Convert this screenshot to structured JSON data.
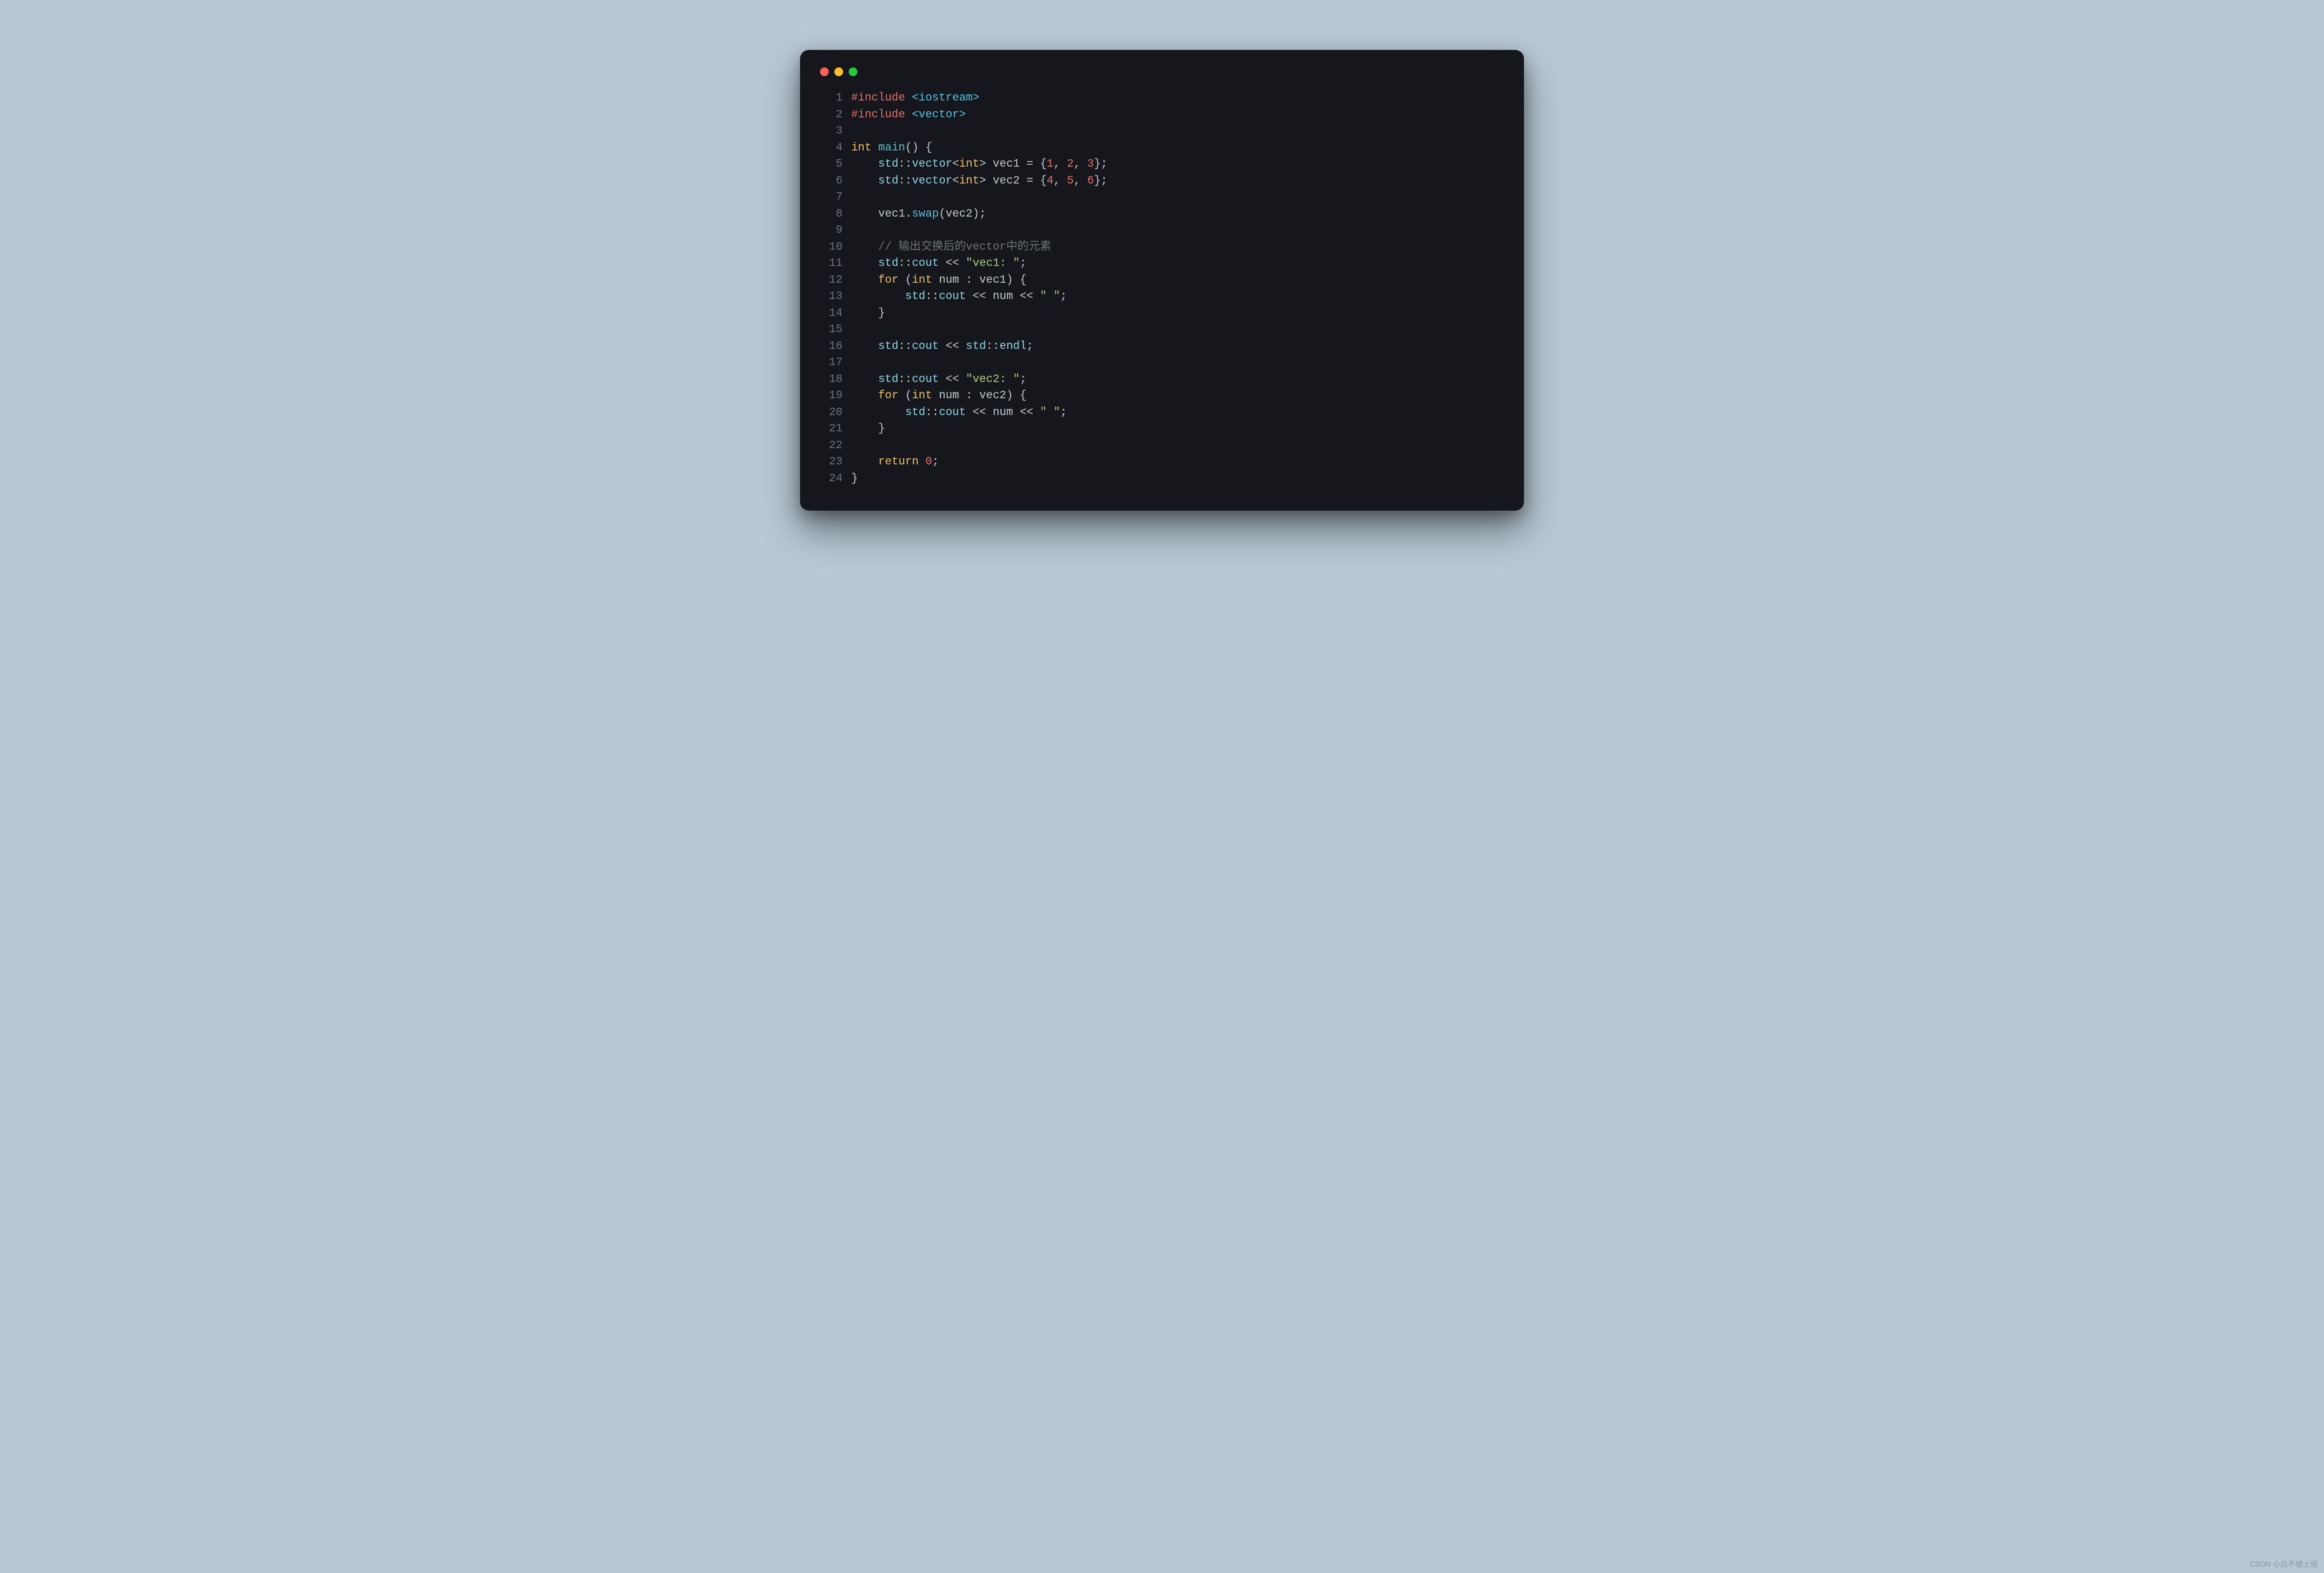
{
  "watermark": "CSDN 小白不想上班",
  "code": {
    "lines": [
      {
        "n": 1,
        "tokens": [
          {
            "t": "#include",
            "c": "pre"
          },
          {
            "t": " "
          },
          {
            "t": "<iostream>",
            "c": "type"
          }
        ]
      },
      {
        "n": 2,
        "tokens": [
          {
            "t": "#include",
            "c": "pre"
          },
          {
            "t": " "
          },
          {
            "t": "<vector>",
            "c": "type"
          }
        ]
      },
      {
        "n": 3,
        "tokens": []
      },
      {
        "n": 4,
        "tokens": [
          {
            "t": "int",
            "c": "kw"
          },
          {
            "t": " "
          },
          {
            "t": "main",
            "c": "fn"
          },
          {
            "t": "() {",
            "c": "op"
          }
        ]
      },
      {
        "n": 5,
        "tokens": [
          {
            "t": "    "
          },
          {
            "t": "std",
            "c": "ident"
          },
          {
            "t": "::",
            "c": "op"
          },
          {
            "t": "vector",
            "c": "ident"
          },
          {
            "t": "<",
            "c": "op"
          },
          {
            "t": "int",
            "c": "kw"
          },
          {
            "t": ">",
            "c": "op"
          },
          {
            "t": " vec1 = {",
            "c": "op"
          },
          {
            "t": "1",
            "c": "num"
          },
          {
            "t": ", ",
            "c": "op"
          },
          {
            "t": "2",
            "c": "num"
          },
          {
            "t": ", ",
            "c": "op"
          },
          {
            "t": "3",
            "c": "num"
          },
          {
            "t": "};",
            "c": "op"
          }
        ]
      },
      {
        "n": 6,
        "tokens": [
          {
            "t": "    "
          },
          {
            "t": "std",
            "c": "ident"
          },
          {
            "t": "::",
            "c": "op"
          },
          {
            "t": "vector",
            "c": "ident"
          },
          {
            "t": "<",
            "c": "op"
          },
          {
            "t": "int",
            "c": "kw"
          },
          {
            "t": ">",
            "c": "op"
          },
          {
            "t": " vec2 = {",
            "c": "op"
          },
          {
            "t": "4",
            "c": "num"
          },
          {
            "t": ", ",
            "c": "op"
          },
          {
            "t": "5",
            "c": "num"
          },
          {
            "t": ", ",
            "c": "op"
          },
          {
            "t": "6",
            "c": "num"
          },
          {
            "t": "};",
            "c": "op"
          }
        ]
      },
      {
        "n": 7,
        "tokens": []
      },
      {
        "n": 8,
        "tokens": [
          {
            "t": "    vec1.",
            "c": "op"
          },
          {
            "t": "swap",
            "c": "fn"
          },
          {
            "t": "(vec2);",
            "c": "op"
          }
        ]
      },
      {
        "n": 9,
        "tokens": []
      },
      {
        "n": 10,
        "tokens": [
          {
            "t": "    "
          },
          {
            "t": "// 输出交换后的vector中的元素",
            "c": "cm"
          }
        ]
      },
      {
        "n": 11,
        "tokens": [
          {
            "t": "    "
          },
          {
            "t": "std",
            "c": "ident"
          },
          {
            "t": "::",
            "c": "op"
          },
          {
            "t": "cout",
            "c": "ident"
          },
          {
            "t": " << ",
            "c": "op"
          },
          {
            "t": "\"vec1: \"",
            "c": "str"
          },
          {
            "t": ";",
            "c": "op"
          }
        ]
      },
      {
        "n": 12,
        "tokens": [
          {
            "t": "    "
          },
          {
            "t": "for",
            "c": "kw"
          },
          {
            "t": " (",
            "c": "op"
          },
          {
            "t": "int",
            "c": "kw"
          },
          {
            "t": " num : vec1) {",
            "c": "op"
          }
        ]
      },
      {
        "n": 13,
        "tokens": [
          {
            "t": "        "
          },
          {
            "t": "std",
            "c": "ident"
          },
          {
            "t": "::",
            "c": "op"
          },
          {
            "t": "cout",
            "c": "ident"
          },
          {
            "t": " << num << ",
            "c": "op"
          },
          {
            "t": "\" \"",
            "c": "str"
          },
          {
            "t": ";",
            "c": "op"
          }
        ]
      },
      {
        "n": 14,
        "tokens": [
          {
            "t": "    }",
            "c": "op"
          }
        ]
      },
      {
        "n": 15,
        "tokens": []
      },
      {
        "n": 16,
        "tokens": [
          {
            "t": "    "
          },
          {
            "t": "std",
            "c": "ident"
          },
          {
            "t": "::",
            "c": "op"
          },
          {
            "t": "cout",
            "c": "ident"
          },
          {
            "t": " << ",
            "c": "op"
          },
          {
            "t": "std",
            "c": "ident"
          },
          {
            "t": "::",
            "c": "op"
          },
          {
            "t": "endl",
            "c": "ident"
          },
          {
            "t": ";",
            "c": "op"
          }
        ]
      },
      {
        "n": 17,
        "tokens": []
      },
      {
        "n": 18,
        "tokens": [
          {
            "t": "    "
          },
          {
            "t": "std",
            "c": "ident"
          },
          {
            "t": "::",
            "c": "op"
          },
          {
            "t": "cout",
            "c": "ident"
          },
          {
            "t": " << ",
            "c": "op"
          },
          {
            "t": "\"vec2: \"",
            "c": "str"
          },
          {
            "t": ";",
            "c": "op"
          }
        ]
      },
      {
        "n": 19,
        "tokens": [
          {
            "t": "    "
          },
          {
            "t": "for",
            "c": "kw"
          },
          {
            "t": " (",
            "c": "op"
          },
          {
            "t": "int",
            "c": "kw"
          },
          {
            "t": " num : vec2) {",
            "c": "op"
          }
        ]
      },
      {
        "n": 20,
        "tokens": [
          {
            "t": "        "
          },
          {
            "t": "std",
            "c": "ident"
          },
          {
            "t": "::",
            "c": "op"
          },
          {
            "t": "cout",
            "c": "ident"
          },
          {
            "t": " << num << ",
            "c": "op"
          },
          {
            "t": "\" \"",
            "c": "str"
          },
          {
            "t": ";",
            "c": "op"
          }
        ]
      },
      {
        "n": 21,
        "tokens": [
          {
            "t": "    }",
            "c": "op"
          }
        ]
      },
      {
        "n": 22,
        "tokens": []
      },
      {
        "n": 23,
        "tokens": [
          {
            "t": "    "
          },
          {
            "t": "return",
            "c": "kw"
          },
          {
            "t": " ",
            "c": "op"
          },
          {
            "t": "0",
            "c": "num"
          },
          {
            "t": ";",
            "c": "op"
          }
        ]
      },
      {
        "n": 24,
        "tokens": [
          {
            "t": "}",
            "c": "op"
          }
        ]
      }
    ]
  }
}
